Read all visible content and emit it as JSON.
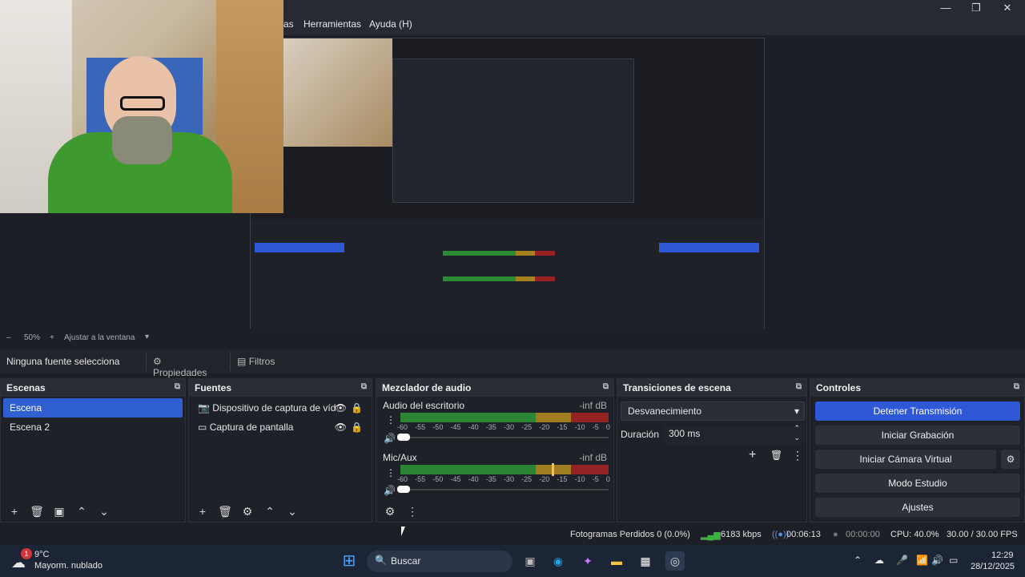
{
  "menu": {
    "items": [
      "as",
      "Herramientas",
      "Ayuda (H)"
    ]
  },
  "window_controls": {
    "minimize": "—",
    "restore": "❐",
    "close": "✕"
  },
  "zoom": {
    "minus": "–",
    "level": "50%",
    "plus": "+",
    "fit_label": "Ajustar a la ventana",
    "dropdown": "▾"
  },
  "context": {
    "no_source": "Ninguna fuente selecciona",
    "properties": "Propiedades",
    "filters": "Filtros"
  },
  "scenes": {
    "title": "Escenas",
    "items": [
      "Escena",
      "Escena 2"
    ]
  },
  "sources": {
    "title": "Fuentes",
    "items": [
      "Dispositivo de captura de vídeo",
      "Captura de pantalla"
    ]
  },
  "mixer": {
    "title": "Mezclador de audio",
    "channels": [
      {
        "name": "Audio del escritorio",
        "level": "-inf dB"
      },
      {
        "name": "Mic/Aux",
        "level": "-inf dB"
      }
    ],
    "scale": [
      "-60",
      "-55",
      "-50",
      "-45",
      "-40",
      "-35",
      "-30",
      "-25",
      "-20",
      "-15",
      "-10",
      "-5",
      "0"
    ]
  },
  "transitions": {
    "title": "Transiciones de escena",
    "selected": "Desvanecimiento",
    "duration_label": "Duración",
    "duration_value": "300 ms"
  },
  "controls": {
    "title": "Controles",
    "buttons": [
      "Detener Transmisión",
      "Iniciar Grabación",
      "Iniciar Cámara Virtual",
      "Modo Estudio",
      "Ajustes"
    ]
  },
  "status": {
    "dropped": "Fotogramas Perdidos 0 (0.0%)",
    "bitrate": "6183 kbps",
    "stream_time": "00:06:13",
    "rec_time": "00:00:00",
    "cpu": "CPU: 40.0%",
    "fps": "30.00 / 30.00 FPS"
  },
  "taskbar": {
    "weather_temp": "9°C",
    "weather_desc": "Mayorm. nublado",
    "weather_badge": "1",
    "search": "Buscar",
    "time": "12:29",
    "date": "28/12/2025"
  },
  "colors": {
    "accent": "#2e58d6",
    "panel": "#1f2129",
    "meter_green": "#2c8a35",
    "meter_yellow": "#a6821f",
    "meter_red": "#9a2222"
  }
}
